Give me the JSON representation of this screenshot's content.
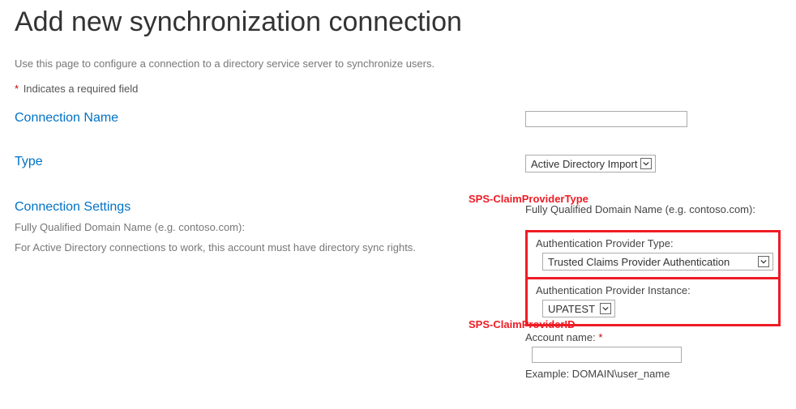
{
  "page": {
    "title": "Add new synchronization connection",
    "description": "Use this page to configure a connection to a directory service server to synchronize users.",
    "required_note": "Indicates a required field"
  },
  "sections": {
    "connection_name": {
      "heading": "Connection Name"
    },
    "type": {
      "heading": "Type",
      "selected": "Active Directory Import"
    },
    "connection_settings": {
      "heading": "Connection Settings",
      "desc_line1": "Fully Qualified Domain Name (e.g. contoso.com):",
      "desc_line2": "For Active Directory connections to work, this account must have directory sync rights.",
      "fqdn_label": "Fully Qualified Domain Name (e.g. contoso.com):",
      "auth_type_label": "Authentication Provider Type:",
      "auth_type_value": "Trusted Claims Provider Authentication",
      "auth_instance_label": "Authentication Provider Instance:",
      "auth_instance_value": "UPATEST",
      "account_label": "Account name:",
      "example": "Example: DOMAIN\\user_name"
    }
  },
  "annotations": {
    "claim_type": "SPS-ClaimProviderType",
    "claim_id": "SPS-ClaimProviderID"
  }
}
